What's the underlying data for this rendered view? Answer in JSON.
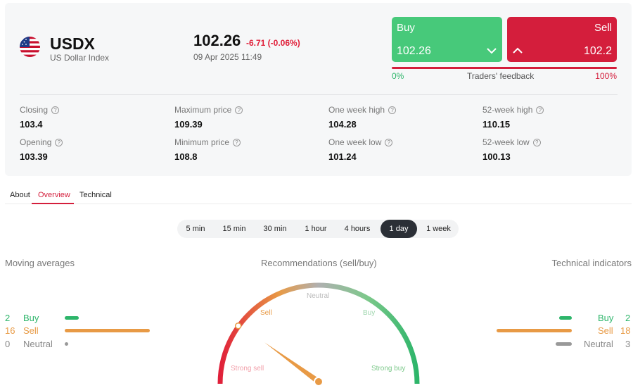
{
  "instrument": {
    "symbol": "USDX",
    "full_name": "US Dollar Index",
    "price": "102.26",
    "change": "-6.71 (-0.06%)",
    "datetime": "09 Apr 2025 11:49"
  },
  "trade": {
    "buy_label": "Buy",
    "buy_value": "102.26",
    "sell_label": "Sell",
    "sell_value": "102.2",
    "feedback_left": "0%",
    "feedback_label": "Traders' feedback",
    "feedback_right": "100%",
    "sell_share": 1.0
  },
  "stats": [
    {
      "label": "Closing",
      "value": "103.4"
    },
    {
      "label": "Maximum price",
      "value": "109.39"
    },
    {
      "label": "One week high",
      "value": "104.28"
    },
    {
      "label": "52-week high",
      "value": "110.15"
    },
    {
      "label": "Opening",
      "value": "103.39"
    },
    {
      "label": "Minimum price",
      "value": "108.8"
    },
    {
      "label": "One week low",
      "value": "101.24"
    },
    {
      "label": "52-week low",
      "value": "100.13"
    }
  ],
  "tabs": [
    {
      "label": "About",
      "active": false
    },
    {
      "label": "Overview",
      "active": true
    },
    {
      "label": "Technical",
      "active": false
    }
  ],
  "periods": [
    {
      "label": "5 min",
      "active": false
    },
    {
      "label": "15 min",
      "active": false
    },
    {
      "label": "30 min",
      "active": false
    },
    {
      "label": "1 hour",
      "active": false
    },
    {
      "label": "4 hours",
      "active": false
    },
    {
      "label": "1 day",
      "active": true
    },
    {
      "label": "1 week",
      "active": false
    }
  ],
  "moving_averages": {
    "title": "Moving averages",
    "buy_count": "2",
    "buy_label": "Buy",
    "sell_count": "16",
    "sell_label": "Sell",
    "neutral_count": "0",
    "neutral_label": "Neutral"
  },
  "technical_indicators": {
    "title": "Technical indicators",
    "buy_count": "2",
    "buy_label": "Buy",
    "sell_count": "18",
    "sell_label": "Sell",
    "neutral_count": "3",
    "neutral_label": "Neutral"
  },
  "recommendation": {
    "title": "Recommendations (sell/buy)",
    "labels": {
      "strong_sell": "Strong sell",
      "sell": "Sell",
      "neutral": "Neutral",
      "buy": "Buy",
      "strong_buy": "Strong buy"
    },
    "current": "Sell",
    "level": 0.2
  },
  "colors": {
    "buy": "#47c97a",
    "sell": "#d41e3c",
    "sell_orange": "#e89a45",
    "neutral": "#999999",
    "accent": "#d41e3c"
  },
  "icons": {
    "flag": "us-flag-icon",
    "buy_chevron": "chevron-down-icon",
    "sell_chevron": "chevron-up-icon",
    "help": "question-circle-icon"
  }
}
